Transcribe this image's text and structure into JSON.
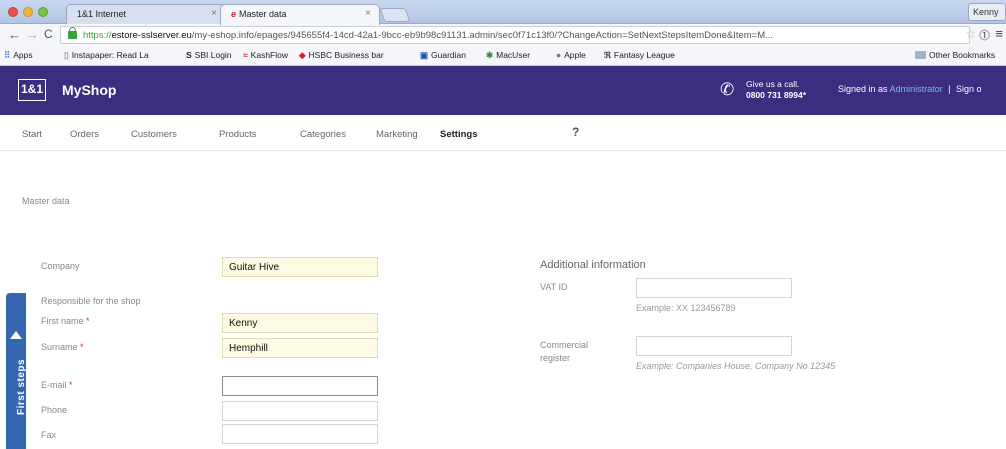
{
  "browser": {
    "tabs": [
      {
        "title": "1&1 Internet",
        "close": "×"
      },
      {
        "title": "Master data",
        "close": "×"
      }
    ],
    "profile_name": "Kenny",
    "url_scheme": "https://",
    "url_host": "estore-sslserver.eu",
    "url_path": "/my-eshop.info/epages/945655f4-14cd-42a1-9bcc-eb9b98c91131.admin/sec0f71c13f0/?ChangeAction=SetNextStepsItemDone&Item=M...",
    "bookmarks": [
      {
        "icon": "apps-icon",
        "label": "Apps"
      },
      {
        "icon": "page-icon",
        "label": "Instapaper: Read La"
      },
      {
        "icon": "sbi-icon",
        "label": "SBI Login"
      },
      {
        "icon": "kashflow-icon",
        "label": "KashFlow"
      },
      {
        "icon": "hsbc-icon",
        "label": "HSBC Business bar"
      },
      {
        "icon": "guardian-icon",
        "label": "Guardian"
      },
      {
        "icon": "macuser-icon",
        "label": "MacUser"
      },
      {
        "icon": "apple-icon",
        "label": "Apple"
      },
      {
        "icon": "fantasy-icon",
        "label": "Fantasy League"
      }
    ],
    "other_bookmarks": "Other Bookmarks"
  },
  "app": {
    "logo": "1&1",
    "title": "MyShop",
    "call_line1": "Give us a call.",
    "call_number": "0800 731 8994*",
    "signed_in_prefix": "Signed in as",
    "signed_in_user": "Administrator",
    "signed_in_sep": "|",
    "signout": "Sign o"
  },
  "nav": {
    "items": [
      "Start",
      "Orders",
      "Customers",
      "Products",
      "Categories",
      "Marketing",
      "Settings"
    ],
    "active": "Settings",
    "help": "?"
  },
  "breadcrumb": "Master data",
  "form": {
    "company_label": "Company",
    "company_value": "Guitar Hive",
    "responsible_heading": "Responsible for the shop",
    "firstname_label": "First name",
    "firstname_value": "Kenny",
    "surname_label": "Surname",
    "surname_value": "Hemphill",
    "email_label": "E-mail",
    "email_value": "",
    "phone_label": "Phone",
    "phone_value": "",
    "fax_label": "Fax",
    "fax_value": "",
    "required_mark": "*"
  },
  "additional": {
    "title": "Additional information",
    "vat_label": "VAT ID",
    "vat_value": "",
    "vat_hint": "Example: XX 123456789",
    "commercial_label_1": "Commercial",
    "commercial_label_2": "register",
    "commercial_value": "",
    "commercial_hint": "Example: Companies House, Company No 12345"
  },
  "first_steps": "First steps",
  "colors": {
    "header_bg": "#3c2d80",
    "first_steps_bg": "#3566b0",
    "required_field_bg": "#fdfbe3",
    "admin_link": "#79b8f0"
  }
}
